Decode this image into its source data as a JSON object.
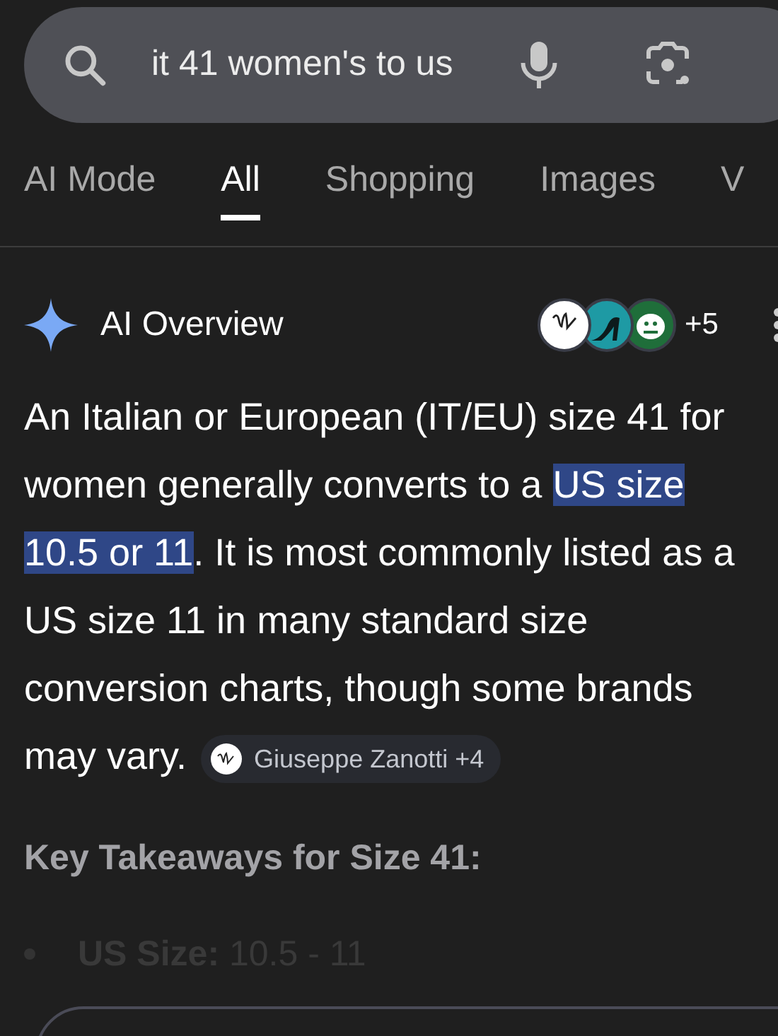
{
  "search": {
    "value": "it 41 women's to us"
  },
  "tabs": [
    {
      "label": "AI Mode",
      "selected": false
    },
    {
      "label": "All",
      "selected": true
    },
    {
      "label": "Shopping",
      "selected": false
    },
    {
      "label": "Images",
      "selected": false
    },
    {
      "label": "V",
      "selected": false
    }
  ],
  "ai_overview": {
    "title": "AI Overview",
    "sources_more": "+5",
    "answer": [
      {
        "text": "An Italian or European (IT/EU) size 41 for women generally converts to a ",
        "highlighted": false
      },
      {
        "text": "US size 10.5 or 11",
        "highlighted": true
      },
      {
        "text": ". It is most commonly listed as a US size 11 in many standard size conversion charts, though some brands may vary.",
        "highlighted": false
      }
    ],
    "citation": "Giuseppe Zanotti +4",
    "heading": "Key Takeaways for Size 41:",
    "bullets": [
      "**US Size:** 10.5 - 11"
    ]
  }
}
